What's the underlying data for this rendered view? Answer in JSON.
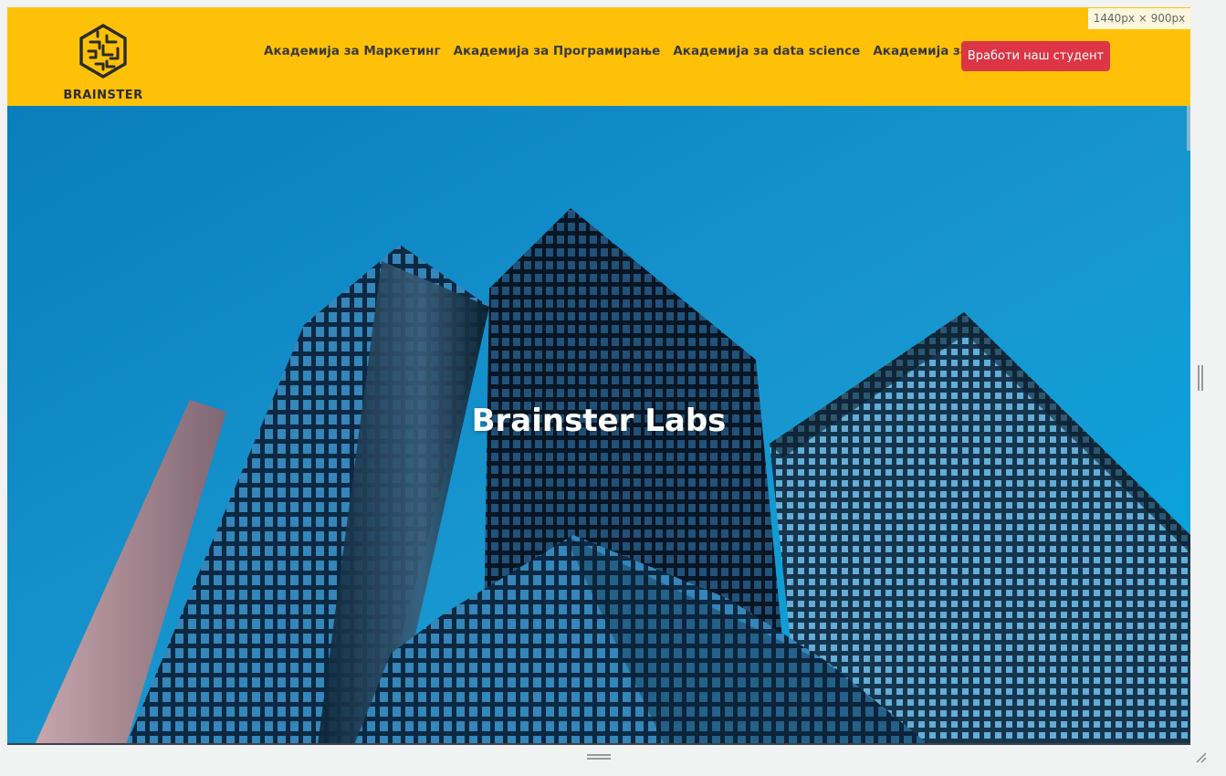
{
  "window": {
    "size_readout": "1440px × 900px"
  },
  "navbar": {
    "logo_text": "BRAINSTER",
    "links": [
      "Академија за Маркетинг",
      "Академија за Програмирање",
      "Академија за data science",
      "Академија за дизајн"
    ],
    "cta_label": "Вработи наш студент"
  },
  "hero": {
    "title": "Brainster Labs"
  },
  "colors": {
    "navbar_bg": "#ffc107",
    "cta_bg": "#dc3545",
    "sky": "#1aa0dc",
    "text_dark": "#3a3a3a"
  },
  "icons": {
    "logo": "brain-maze-icon"
  }
}
